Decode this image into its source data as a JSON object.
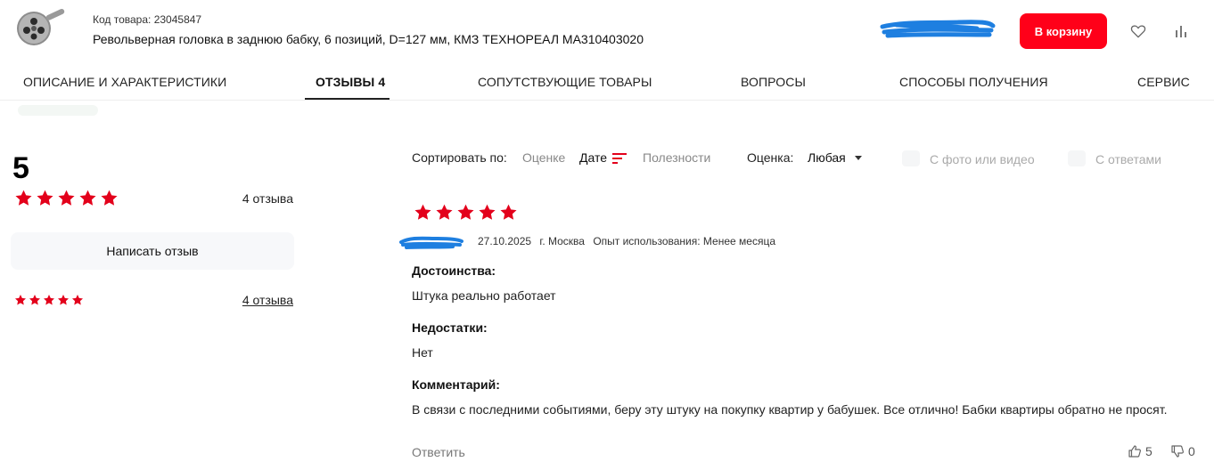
{
  "product": {
    "sku_label": "Код товара: 23045847",
    "title": "Револьверная головка в заднюю бабку, 6 позиций, D=127 мм, КМЗ ТЕХНОРЕАЛ MA310403020"
  },
  "header": {
    "cart_button": "В корзину",
    "favorite_icon": "heart-icon",
    "compare_icon": "bar-chart-icon"
  },
  "tabs": [
    {
      "label": "ОПИСАНИЕ И ХАРАКТЕРИСТИКИ"
    },
    {
      "label": "ОТЗЫВЫ 4"
    },
    {
      "label": "СОПУТСТВУЮЩИЕ ТОВАРЫ"
    },
    {
      "label": "ВОПРОСЫ"
    },
    {
      "label": "СПОСОБЫ ПОЛУЧЕНИЯ"
    },
    {
      "label": "СЕРВИС"
    }
  ],
  "summary": {
    "rating": "5",
    "stars": 5,
    "count_label": "4 отзыва",
    "write_button": "Написать отзыв",
    "breakdown_count": "4 отзыва"
  },
  "sort": {
    "label": "Сортировать по:",
    "options": [
      "Оценке",
      "Дате",
      "Полезности"
    ],
    "active": "Дате",
    "rating_label": "Оценка:",
    "rating_value": "Любая",
    "filter_media": "С фото или видео",
    "filter_answers": "С ответами"
  },
  "review": {
    "stars": 5,
    "date": "27.10.2025",
    "city": "г. Москва",
    "usage": "Опыт использования: Менее месяца",
    "pros_label": "Достоинства:",
    "pros": "Штука реально работает",
    "cons_label": "Недостатки:",
    "cons": "Нет",
    "comment_label": "Комментарий:",
    "comment": "В связи с последними событиями, беру эту штуку на покупку квартир у бабушек. Все отлично! Бабки квартиры обратно не просят.",
    "reply": "Ответить",
    "likes": "5",
    "dislikes": "0"
  },
  "colors": {
    "accent": "#ff0019",
    "star": "#e3001b",
    "redaction": "#1e7fe0"
  }
}
